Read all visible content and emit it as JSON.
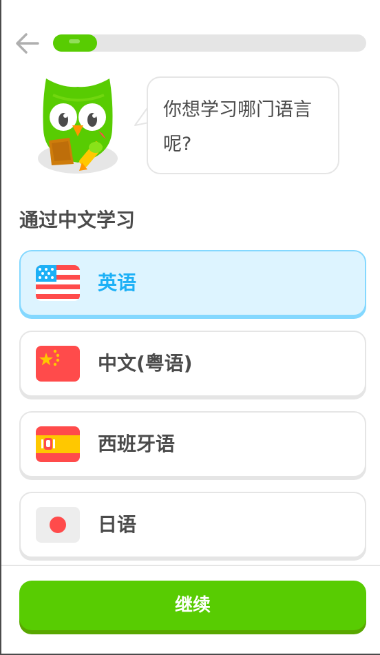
{
  "progress": {
    "value": 0.14
  },
  "speech_bubble": {
    "text": "你想学习哪门语言呢?"
  },
  "section": {
    "title": "通过中文学习"
  },
  "languages": [
    {
      "label": "英语",
      "flag": "us-flag-icon",
      "selected": true
    },
    {
      "label": "中文(粤语)",
      "flag": "china-flag-icon",
      "selected": false
    },
    {
      "label": "西班牙语",
      "flag": "spain-flag-icon",
      "selected": false
    },
    {
      "label": "日语",
      "flag": "japan-flag-icon",
      "selected": false
    }
  ],
  "continue_button": {
    "label": "继续"
  },
  "colors": {
    "brand_green": "#58cc02",
    "brand_green_dark": "#58a700",
    "selected_border": "#84d8ff",
    "selected_bg": "#ddf4ff",
    "selected_text": "#1cb0f6",
    "text": "#4b4b4b",
    "border": "#e5e5e5"
  }
}
